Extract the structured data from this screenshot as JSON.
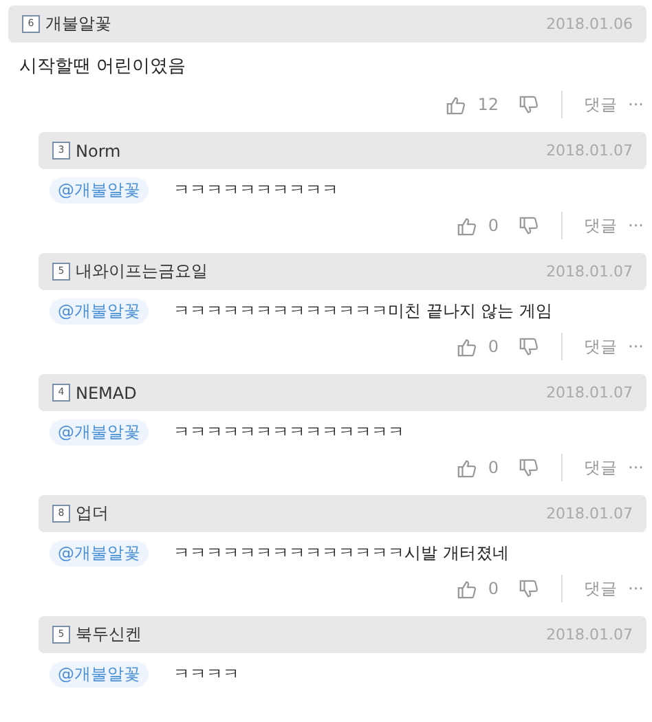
{
  "comment": {
    "rank": "6",
    "author": "개불알꽃",
    "date": "2018.01.06",
    "text": "시작할땐 어린이였음",
    "likes": "12",
    "reply_label": "댓글",
    "more": "···"
  },
  "replies": [
    {
      "rank": "3",
      "author": "Norm",
      "date": "2018.01.07",
      "mention": "@개불알꽃",
      "text": "ㅋㅋㅋㅋㅋㅋㅋㅋㅋㅋ",
      "actions": {
        "likes": "0",
        "reply_label": "댓글",
        "more": "···"
      }
    },
    {
      "rank": "5",
      "author": "내와이프는금요일",
      "date": "2018.01.07",
      "mention": "@개불알꽃",
      "text": "ㅋㅋㅋㅋㅋㅋㅋㅋㅋㅋㅋㅋㅋ미친 끝나지 않는 게임",
      "actions": {
        "likes": "0",
        "reply_label": "댓글",
        "more": "···"
      }
    },
    {
      "rank": "4",
      "author": "NEMAD",
      "date": "2018.01.07",
      "mention": "@개불알꽃",
      "text": "ㅋㅋㅋㅋㅋㅋㅋㅋㅋㅋㅋㅋㅋㅋ",
      "actions": {
        "likes": "0",
        "reply_label": "댓글",
        "more": "···"
      }
    },
    {
      "rank": "8",
      "author": "업더",
      "date": "2018.01.07",
      "mention": "@개불알꽃",
      "text": "ㅋㅋㅋㅋㅋㅋㅋㅋㅋㅋㅋㅋㅋㅋ시발 개터졌네",
      "actions": {
        "likes": "0",
        "reply_label": "댓글",
        "more": "···"
      }
    },
    {
      "rank": "5",
      "author": "북두신켄",
      "date": "2018.01.07",
      "mention": "@개불알꽃",
      "text": "ㅋㅋㅋㅋ"
    }
  ]
}
